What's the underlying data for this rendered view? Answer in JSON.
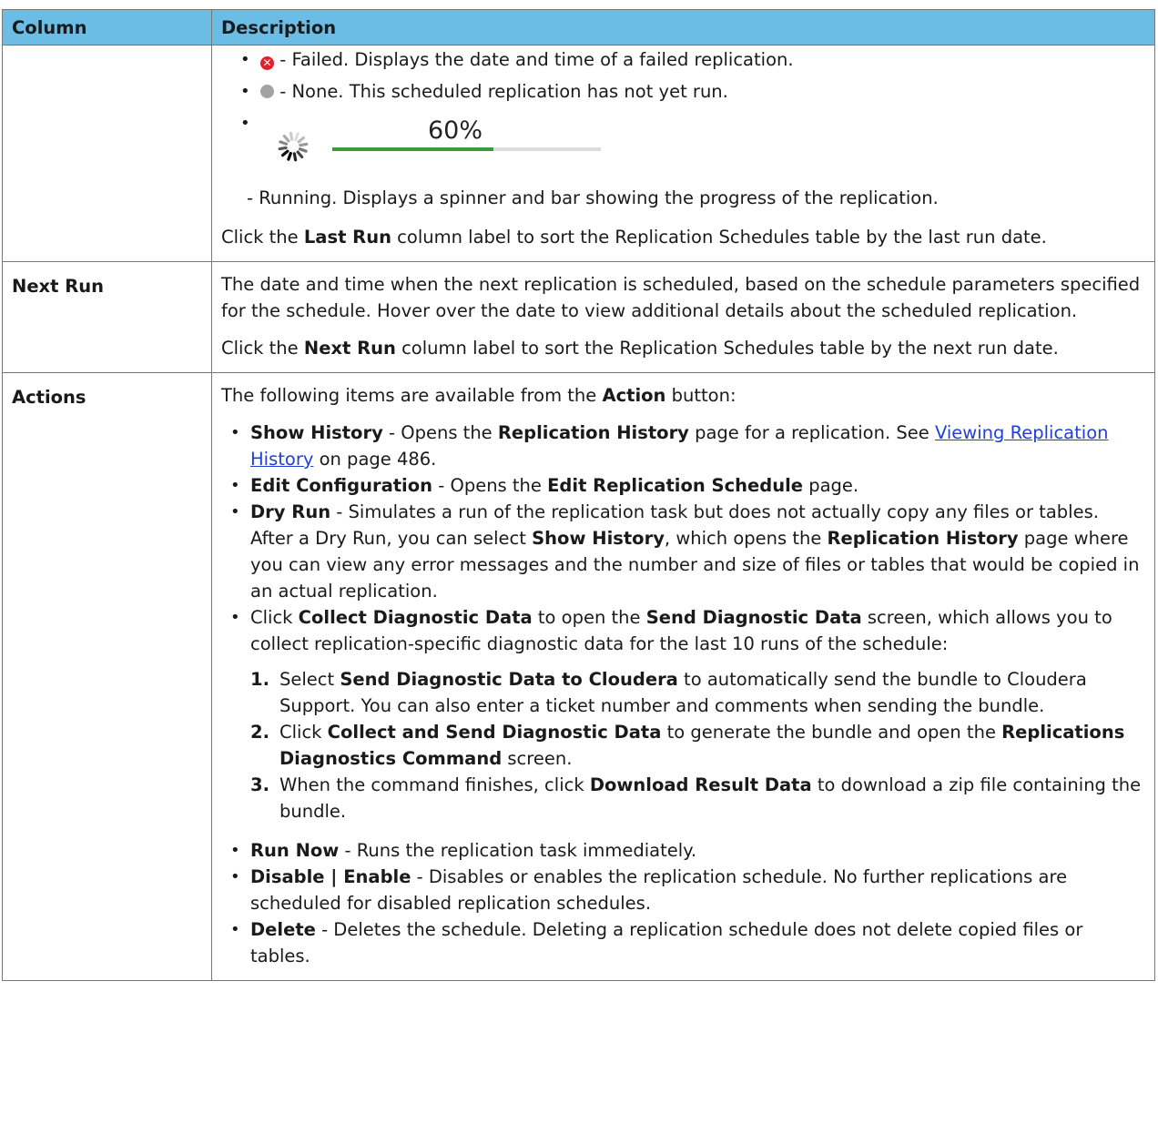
{
  "header": {
    "col1": "Column",
    "col2": "Description"
  },
  "last_run": {
    "failed_text": "- Failed. Displays the date and time of a failed replication.",
    "none_text": "- None. This scheduled replication has not yet run.",
    "progress_label": "60%",
    "progress_value": 0.6,
    "running_text": "- Running. Displays a spinner and bar showing the progress of the replication.",
    "sort_pre": "Click the ",
    "sort_bold": "Last Run",
    "sort_post": " column label to sort the Replication Schedules table by the last run date."
  },
  "next_run": {
    "label": "Next Run",
    "desc": "The date and time when the next replication is scheduled, based on the schedule parameters specified for the schedule. Hover over the date to view additional details about the scheduled replication.",
    "sort_pre": "Click the ",
    "sort_bold": "Next Run",
    "sort_post": " column label to sort the Replication Schedules table by the next run date."
  },
  "actions": {
    "label": "Actions",
    "intro_pre": "The following items are available from the ",
    "intro_bold": "Action",
    "intro_post": " button:",
    "show_history": {
      "b1": "Show History",
      "t1": " - Opens the ",
      "b2": "Replication History",
      "t2": " page for a replication. See ",
      "link": "Viewing Replication History",
      "t3": " on page 486."
    },
    "edit_config": {
      "b1": "Edit Configuration",
      "t1": " - Opens the ",
      "b2": "Edit Replication Schedule",
      "t2": " page."
    },
    "dry_run": {
      "b1": "Dry Run",
      "t1": " - Simulates a run of the replication task but does not actually copy any files or tables. After a Dry Run, you can select ",
      "b2": "Show History",
      "t2": ", which opens the ",
      "b3": "Replication History",
      "t3": " page where you can view any error messages and the number and size of files or tables that would be copied in an actual replication."
    },
    "collect": {
      "t0": "Click ",
      "b1": "Collect Diagnostic Data",
      "t1": " to open the ",
      "b2": "Send Diagnostic Data",
      "t2": " screen, which allows you to collect replication-specific diagnostic data for the last 10 runs of the schedule:",
      "steps": [
        {
          "num": "1.",
          "t0": "Select ",
          "b1": "Send Diagnostic Data to Cloudera",
          "t1": " to automatically send the bundle to Cloudera Support. You can also enter a ticket number and comments when sending the bundle.",
          "b2": "",
          "t2": ""
        },
        {
          "num": "2.",
          "t0": "Click ",
          "b1": "Collect and Send Diagnostic Data",
          "t1": " to generate the bundle and open the ",
          "b2": "Replications Diagnostics Command",
          "t2": " screen."
        },
        {
          "num": "3.",
          "t0": "When the command finishes, click ",
          "b1": "Download Result Data",
          "t1": " to download a zip file containing the bundle.",
          "b2": "",
          "t2": ""
        }
      ]
    },
    "run_now": {
      "b1": "Run Now",
      "t1": " - Runs the replication task immediately."
    },
    "disable": {
      "b1": "Disable | Enable",
      "t1": " - Disables or enables the replication schedule. No further replications are scheduled for disabled replication schedules."
    },
    "delete": {
      "b1": "Delete",
      "t1": " - Deletes the schedule. Deleting a replication schedule does not delete copied files or tables."
    }
  }
}
